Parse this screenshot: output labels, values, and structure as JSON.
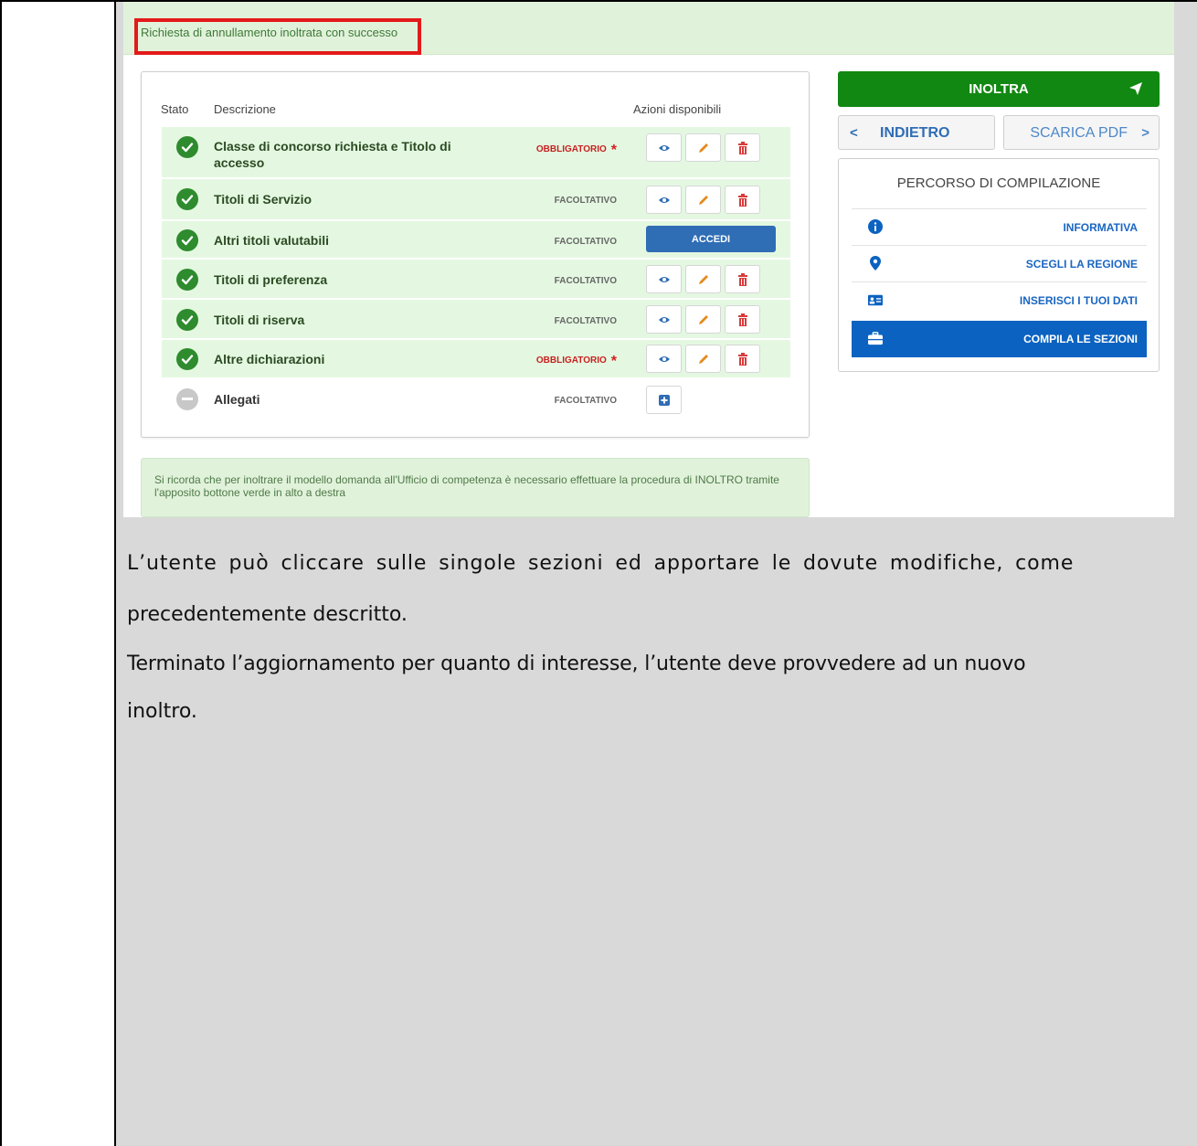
{
  "screenshot": {
    "success_message": "Richiesta di annullamento inoltrata con successo",
    "table": {
      "headers": {
        "stato": "Stato",
        "descrizione": "Descrizione",
        "azioni": "Azioni disponibili"
      },
      "rows": [
        {
          "label": "Classe di concorso richiesta e Titolo di accesso",
          "requirement": "OBBLIGATORIO",
          "mandatory": true,
          "status": "complete",
          "actions": "view-edit-delete"
        },
        {
          "label": "Titoli di Servizio",
          "requirement": "FACOLTATIVO",
          "mandatory": false,
          "status": "complete",
          "actions": "view-edit-delete"
        },
        {
          "label": "Altri titoli valutabili",
          "requirement": "FACOLTATIVO",
          "mandatory": false,
          "status": "complete",
          "actions": "accedi",
          "accedi_label": "ACCEDI"
        },
        {
          "label": "Titoli di preferenza",
          "requirement": "FACOLTATIVO",
          "mandatory": false,
          "status": "complete",
          "actions": "view-edit-delete"
        },
        {
          "label": "Titoli di riserva",
          "requirement": "FACOLTATIVO",
          "mandatory": false,
          "status": "complete",
          "actions": "view-edit-delete"
        },
        {
          "label": "Altre dichiarazioni",
          "requirement": "OBBLIGATORIO",
          "mandatory": true,
          "status": "complete",
          "actions": "view-edit-delete"
        },
        {
          "label": "Allegati",
          "requirement": "FACOLTATIVO",
          "mandatory": false,
          "status": "empty",
          "actions": "add"
        }
      ],
      "mandatory_marker": "*"
    },
    "note": "Si ricorda che per inoltrare il modello domanda all'Ufficio di competenza è necessario effettuare la procedura di INOLTRO tramite l'apposito bottone verde in alto a destra",
    "sidebar": {
      "inoltra_label": "INOLTRA",
      "back_label": "INDIETRO",
      "pdf_label": "SCARICA PDF",
      "back_chevron": "<",
      "pdf_chevron": ">",
      "panel_title": "PERCORSO DI COMPILAZIONE",
      "steps": [
        {
          "label": "INFORMATIVA",
          "icon": "info-icon",
          "active": false
        },
        {
          "label": "SCEGLI LA REGIONE",
          "icon": "map-pin-icon",
          "active": false
        },
        {
          "label": "INSERISCI I TUOI DATI",
          "icon": "id-card-icon",
          "active": false
        },
        {
          "label": "COMPILA LE SEZIONI",
          "icon": "briefcase-icon",
          "active": true
        }
      ]
    }
  },
  "document": {
    "paragraph_1_line_1": "L’utente può cliccare sulle singole sezioni ed apportare le dovute modifiche, come",
    "paragraph_1_line_2": "precedentemente descritto.",
    "paragraph_2_line_1": "Terminato l’aggiornamento per quanto di interesse, l’utente deve provvedere ad un nuovo",
    "paragraph_2_line_2": "inoltro."
  },
  "colors": {
    "success_bg": "#e1f2db",
    "highlight_red": "#e31a1a",
    "inoltra_green": "#118811",
    "primary_blue": "#0b62c0",
    "row_complete_bg": "#e4f8e1"
  }
}
